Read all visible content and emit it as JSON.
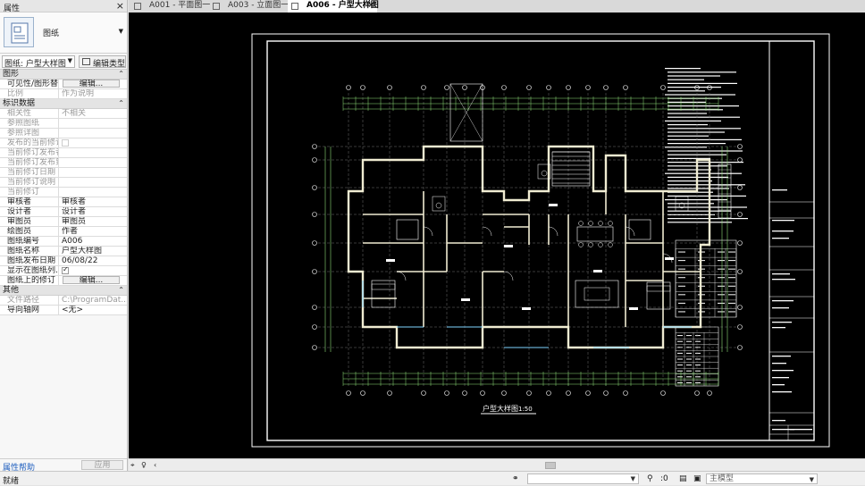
{
  "properties": {
    "title": "属性",
    "type_name": "图纸",
    "selector": "图纸: 户型大样图",
    "edit_type_label": "编辑类型",
    "sections": {
      "graphics": "图形",
      "identity": "标识数据",
      "other": "其他"
    },
    "graphics_rows": [
      {
        "key": "可见性/图形替换",
        "button": "编辑..."
      },
      {
        "key": "比例",
        "value": "作为说明"
      }
    ],
    "identity_rows": [
      {
        "key": "相关性",
        "value": "不相关"
      },
      {
        "key": "参照图纸",
        "value": ""
      },
      {
        "key": "参照详图",
        "value": ""
      },
      {
        "key": "发布的当前修订",
        "value": ""
      },
      {
        "key": "当前修订发布者",
        "value": ""
      },
      {
        "key": "当前修订发布到",
        "value": ""
      },
      {
        "key": "当前修订日期",
        "value": ""
      },
      {
        "key": "当前修订说明",
        "value": ""
      },
      {
        "key": "当前修订",
        "value": ""
      },
      {
        "key": "审核者",
        "value": "审核者"
      },
      {
        "key": "设计者",
        "value": "设计者"
      },
      {
        "key": "审图员",
        "value": "审图员"
      },
      {
        "key": "绘图员",
        "value": "作者"
      },
      {
        "key": "图纸编号",
        "value": "A006"
      },
      {
        "key": "图纸名称",
        "value": "户型大样图"
      },
      {
        "key": "图纸发布日期",
        "value": "06/08/22"
      },
      {
        "key": "显示在图纸列...",
        "checked": true
      },
      {
        "key": "图纸上的修订",
        "button": "编辑..."
      }
    ],
    "other_rows": [
      {
        "key": "文件路径",
        "value": "C:\\ProgramDat..."
      },
      {
        "key": "导向轴网",
        "value": "<无>"
      }
    ],
    "help_link": "属性帮助",
    "apply_label": "应用"
  },
  "tabs": [
    {
      "label": "A001 - 平面图一",
      "active": false
    },
    {
      "label": "A003 - 立面图一",
      "active": false
    },
    {
      "label": "A006 - 户型大样图",
      "active": true
    }
  ],
  "drawing": {
    "view_title": "户型大样图",
    "view_scale": "1:50"
  },
  "statusbar": {
    "text": "就绪",
    "zero_count": ":0",
    "model_select": "主模型"
  },
  "colors": {
    "canvas_bg": "#000000",
    "drawing_line": "#ffffff",
    "dimension": "#8fe07a",
    "wall": "#f0ecd2"
  }
}
